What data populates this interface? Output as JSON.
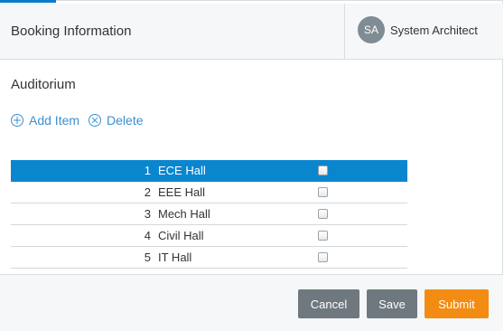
{
  "header": {
    "title": "Booking Information",
    "user": {
      "initials": "SA",
      "name": "System Architect"
    }
  },
  "section": {
    "title": "Auditorium"
  },
  "actions": {
    "add_label": "Add Item",
    "delete_label": "Delete"
  },
  "table": {
    "rows": [
      {
        "num": "1",
        "name": "ECE Hall",
        "checked": false,
        "selected": true
      },
      {
        "num": "2",
        "name": "EEE Hall",
        "checked": false,
        "selected": false
      },
      {
        "num": "3",
        "name": "Mech Hall",
        "checked": false,
        "selected": false
      },
      {
        "num": "4",
        "name": "Civil Hall",
        "checked": false,
        "selected": false
      },
      {
        "num": "5",
        "name": "IT Hall",
        "checked": false,
        "selected": false
      }
    ]
  },
  "footer": {
    "cancel_label": "Cancel",
    "save_label": "Save",
    "submit_label": "Submit"
  },
  "colors": {
    "accent": "#0a86cf",
    "submit": "#f28c13",
    "secondary_button": "#6f787f"
  }
}
